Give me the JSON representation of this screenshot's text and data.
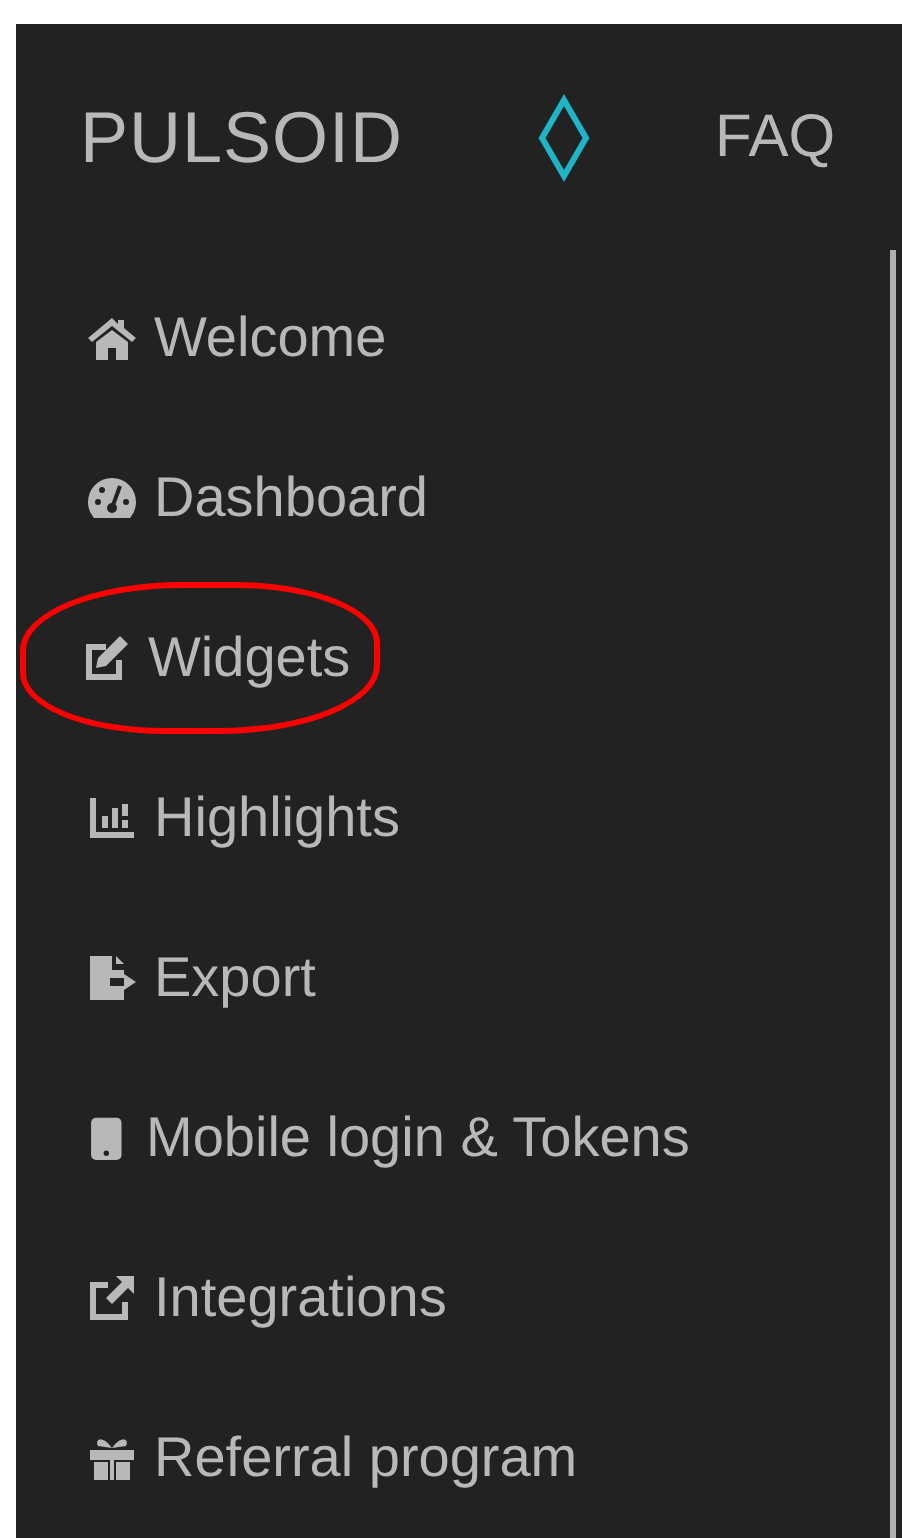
{
  "header": {
    "brand": "PULSOID",
    "nav_link": "FAQ"
  },
  "sidebar": {
    "items": [
      {
        "label": "Welcome",
        "circled": false
      },
      {
        "label": "Dashboard",
        "circled": false
      },
      {
        "label": "Widgets",
        "circled": true
      },
      {
        "label": "Highlights",
        "circled": false
      },
      {
        "label": "Export",
        "circled": false
      },
      {
        "label": "Mobile login & Tokens",
        "circled": false
      },
      {
        "label": "Integrations",
        "circled": false
      },
      {
        "label": "Referral program",
        "circled": false
      }
    ]
  }
}
